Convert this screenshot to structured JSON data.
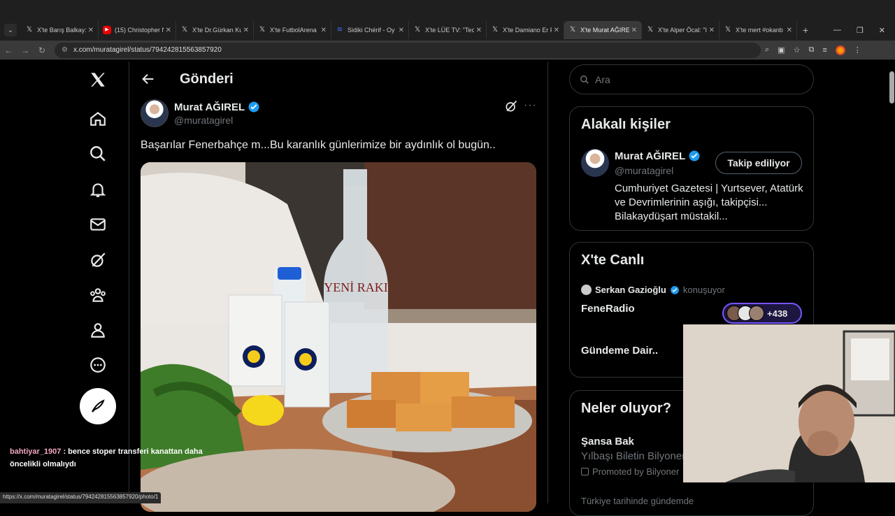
{
  "browser": {
    "tabs": [
      {
        "label": "X'te Barış Balkay:",
        "fav": "X",
        "active": false
      },
      {
        "label": "(15) Christopher N",
        "fav": "yt",
        "active": false
      },
      {
        "label": "X'te Dr.Gürkan Ku",
        "fav": "X",
        "active": false
      },
      {
        "label": "X'te FutbolArena",
        "fav": "X",
        "active": false
      },
      {
        "label": "Sidiki Chérif - Oy",
        "fav": "blue",
        "active": false
      },
      {
        "label": "X'te LÜE TV: \"Tech",
        "fav": "X",
        "active": false
      },
      {
        "label": "X'te Damiano Er F",
        "fav": "X",
        "active": false
      },
      {
        "label": "X'te Murat AĞIREL",
        "fav": "X",
        "active": true
      },
      {
        "label": "X'te Alper Öcal: \"I",
        "fav": "X",
        "active": false
      },
      {
        "label": "X'te mert #okanb",
        "fav": "X",
        "active": false
      }
    ],
    "url": "x.com/muratagirel/status/794242815563857920",
    "status_url": "https://x.com/muratagirel/status/794242815563857920/photo/1"
  },
  "header": {
    "title": "Gönderi"
  },
  "post": {
    "author_name": "Murat AĞIREL",
    "author_handle": "@muratagirel",
    "text": "Başarılar Fenerbahçe m...Bu karanlık günlerimize bir aydınlık ol bugün..",
    "photo_bottle_label": "YENİ RAKI"
  },
  "sidebar": {
    "search_placeholder": "Ara",
    "related": {
      "title": "Alakalı kişiler",
      "name": "Murat AĞIREL",
      "handle": "@muratagirel",
      "follow_label": "Takip ediliyor",
      "bio": "Cumhuriyet Gazetesi | Yurtsever, Atatürk ve Devrimlerinin aşığı, takipçisi... Bilakaydüşart müstakil..."
    },
    "live": {
      "title": "X'te Canlı",
      "host": "Serkan Gazioğlu",
      "speaking": "konuşuyor",
      "space_title": "FeneRadio",
      "listeners": "+438",
      "space_title2": "Gündeme Dair.."
    },
    "trends": {
      "title": "Neler oluyor?",
      "item_title": "Şansa Bak",
      "item_sub": "Yılbaşı Biletin Bilyoner'de!",
      "promo": "Promoted by Bilyoner",
      "next": "Türkiye tarihinde gündemde"
    }
  },
  "chat": {
    "user": "bahtiyar_1907",
    "message": ": bence stoper transferi kanattan daha öncelikli olmalıydı"
  },
  "colors": {
    "accent": "#1d9bf0",
    "verified": "#1d9bf0",
    "live": "#7856ff"
  }
}
